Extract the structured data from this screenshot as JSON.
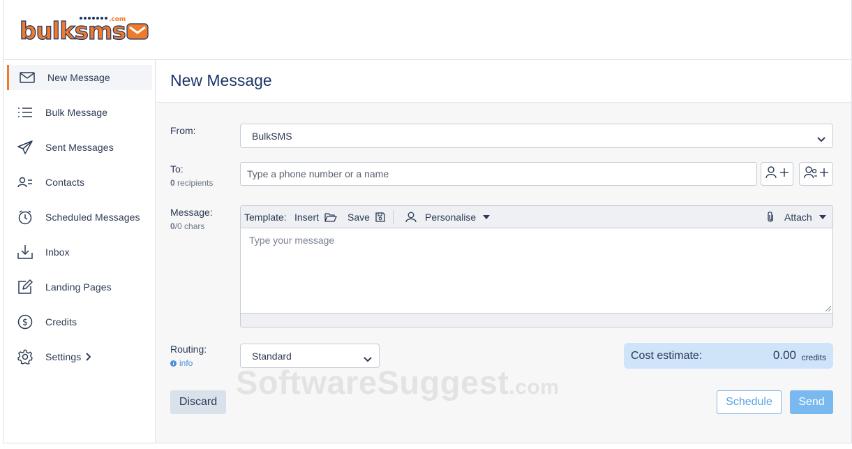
{
  "brand": {
    "logo_text": "bulksms",
    "logo_superscript": ".com",
    "colors": {
      "accent": "#ef7a2b",
      "title": "#1d3566",
      "primary": "#7ab8f0",
      "cost_bg": "#cfe4f9"
    }
  },
  "sidebar": {
    "items": [
      {
        "label": "New Message",
        "icon": "envelope-icon",
        "active": true
      },
      {
        "label": "Bulk Message",
        "icon": "list-icon"
      },
      {
        "label": "Sent Messages",
        "icon": "paper-plane-icon"
      },
      {
        "label": "Contacts",
        "icon": "contacts-icon"
      },
      {
        "label": "Scheduled Messages",
        "icon": "stopwatch-icon"
      },
      {
        "label": "Inbox",
        "icon": "inbox-download-icon"
      },
      {
        "label": "Landing Pages",
        "icon": "edit-square-icon"
      },
      {
        "label": "Credits",
        "icon": "dollar-circle-icon"
      },
      {
        "label": "Settings",
        "icon": "gear-icon",
        "chevron": "chevron-right-icon"
      }
    ]
  },
  "main": {
    "title": "New Message",
    "from": {
      "label": "From:",
      "value": "BulkSMS"
    },
    "to": {
      "label": "To:",
      "recipients_count": "0",
      "recipients_label": "recipients",
      "placeholder": "Type a phone number or a name",
      "add_contact_icon": "add-contact-icon",
      "add_group_icon": "add-group-icon"
    },
    "message": {
      "label": "Message:",
      "chars_used": "0",
      "chars_suffix": "/0 chars",
      "placeholder": "Type your message",
      "toolbar": {
        "template_label": "Template:",
        "insert_label": "Insert",
        "save_label": "Save",
        "personalise_label": "Personalise",
        "attach_label": "Attach"
      }
    },
    "routing": {
      "label": "Routing:",
      "info_label": "info",
      "value": "Standard"
    },
    "cost": {
      "label": "Cost estimate:",
      "value": "0.00",
      "unit": "credits"
    },
    "buttons": {
      "discard": "Discard",
      "schedule": "Schedule",
      "send": "Send"
    }
  },
  "watermark": {
    "text": "SoftwareSuggest",
    "suffix": ".com"
  }
}
